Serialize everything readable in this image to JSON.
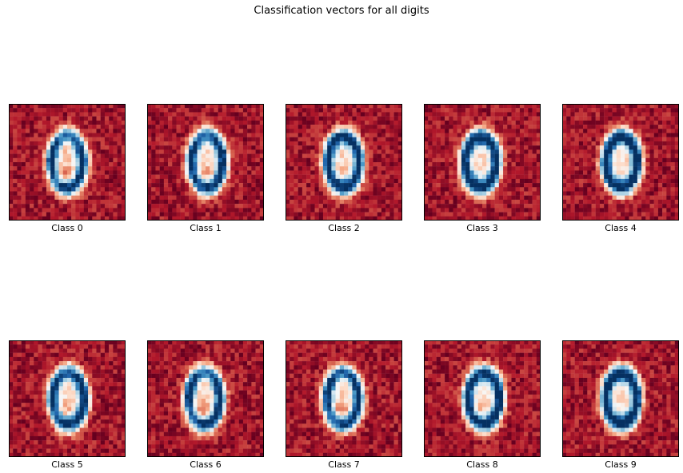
{
  "chart_data": {
    "type": "heatmap",
    "title": "Classification vectors for all digits",
    "colormap": "RdBu",
    "grid": false,
    "axes_ticks": false,
    "panels": [
      {
        "label": "Class 0"
      },
      {
        "label": "Class 1"
      },
      {
        "label": "Class 2"
      },
      {
        "label": "Class 3"
      },
      {
        "label": "Class 4"
      },
      {
        "label": "Class 5"
      },
      {
        "label": "Class 6"
      },
      {
        "label": "Class 7"
      },
      {
        "label": "Class 8"
      },
      {
        "label": "Class 9"
      }
    ]
  }
}
